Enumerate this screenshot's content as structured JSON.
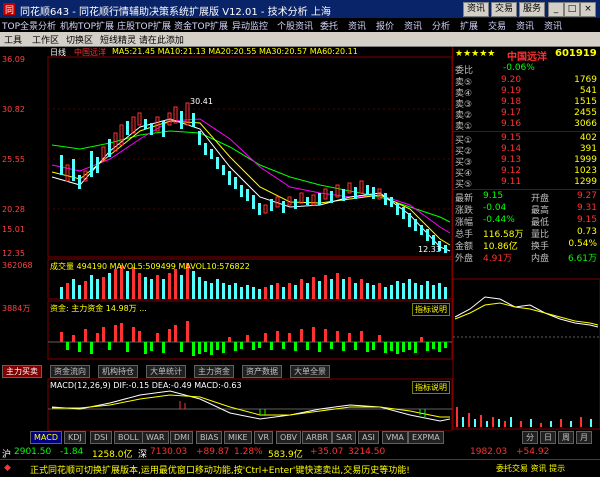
{
  "window": {
    "title": "同花顺643 - 同花顺行情辅助决策系统扩展版 V12.01 - 技术分析 上海",
    "tabs": [
      "资讯",
      "交易",
      "服务"
    ],
    "controls": [
      "minimize",
      "restore",
      "close"
    ]
  },
  "funcbar": {
    "items": [
      "TOP全景分析",
      "机构TOP扩展",
      "庄股TOP扩展",
      "资金TOP扩展",
      "异动监控",
      "个股资讯",
      "委托",
      "资讯",
      "报价",
      "资讯",
      "分析",
      "扩展",
      "交易",
      "资讯",
      "资讯"
    ]
  },
  "menubar": {
    "items": [
      "工具",
      "工作区",
      "切换区",
      "短线精灵 请在此添加"
    ]
  },
  "quote": {
    "stock_name": "中国远洋",
    "stock_code": "601919",
    "change_label": "委比",
    "change_value": "-0.06%",
    "ask_labels": [
      "卖⑤",
      "卖④",
      "卖③",
      "卖②",
      "卖①"
    ],
    "ask_prices": [
      "9.20",
      "9.19",
      "9.18",
      "9.17",
      "9.16"
    ],
    "ask_vols": [
      "1769",
      "541",
      "1515",
      "2455",
      "3066"
    ],
    "bid_labels": [
      "买①",
      "买②",
      "买③",
      "买④",
      "买⑤"
    ],
    "bid_prices": [
      "9.15",
      "9.14",
      "9.13",
      "9.12",
      "9.11"
    ],
    "bid_vols": [
      "402",
      "391",
      "1999",
      "1023",
      "1299"
    ],
    "info_rows": [
      {
        "label": "最新",
        "value": "9.15",
        "label2": "开盘",
        "value2": "9.27"
      },
      {
        "label": "涨跌",
        "value": "-0.04",
        "label2": "最高",
        "value2": "9.31"
      },
      {
        "label": "涨幅",
        "value": "-0.44%",
        "label2": "最低",
        "value2": "9.15"
      },
      {
        "label": "总手",
        "value": "116.58万",
        "label2": "量比",
        "value2": "0.73"
      },
      {
        "label": "金额",
        "value": "10.86亿",
        "label2": "换手",
        "value2": "0.54%"
      },
      {
        "label": "外盘",
        "value": "4.91万",
        "label2": "内盘",
        "value2": "6.61万"
      }
    ]
  },
  "chart_header": {
    "period": "日线",
    "name": "中国远洋",
    "ma_text": "MA5:21.45 MA10:21.13 MA20:20.55 MA30:20.57 MA60:20.11"
  },
  "price_axis": [
    "36.09",
    "30.82",
    "25.55",
    "20.28",
    "15.01",
    "12.35"
  ],
  "price_marks": {
    "high": "30.41",
    "low": "12.33"
  },
  "volume_panel": {
    "label": "成交量 494190 MAVOL5:509499 MAVOL10:576822",
    "axis": "362068"
  },
  "flow_panel": {
    "label": "资金: 主力资金 14.98万 ...",
    "axis": "3884万",
    "button": "指标说明"
  },
  "macd_panel": {
    "label": "MACD(12,26,9) DIF:-0.15 DEA:-0.49 MACD:-0.63",
    "button": "指标说明",
    "tabs": [
      "主力买卖",
      "资金流向",
      "机构持仓",
      "大单统计",
      "主力资金",
      "资产数据",
      "大单全景"
    ]
  },
  "bottom_tabs": [
    "MACD",
    "KDJ",
    "DSI",
    "BOLL",
    "WAR",
    "DMI",
    "BIAS",
    "MIKE",
    "VR",
    "OBV",
    "ARBR",
    "SAR",
    "ASI",
    "VMA",
    "EXPMA"
  ],
  "bottom_tabs_right": [
    "分",
    "日",
    "周",
    "月"
  ],
  "tickers": [
    {
      "name": "沪",
      "value": "2901.50",
      "change": "-1.84",
      "vol": "1258.0亿"
    },
    {
      "name": "深",
      "value": "7130.03",
      "change": "+89.87",
      "vol": "1.28%"
    },
    {
      "name": "",
      "value": "583.9亿",
      "change": "+35.07",
      "vol": "3214.50"
    },
    {
      "name": "",
      "value": "1982.03",
      "change": "+54.92",
      "vol": ""
    }
  ],
  "news": "正式同花顺可切换扩展版本,运用最优窗口移动功能,按'Ctrl+Enter'键快速卖出,交易历史等功能!",
  "ticker_right": "委托交易 资讯 提示",
  "colors": {
    "up": "#ff3232",
    "down": "#54ffff",
    "ma5": "#ffffff",
    "ma10": "#ffff00",
    "ma20": "#ff00ff",
    "ma30": "#00ff00"
  }
}
